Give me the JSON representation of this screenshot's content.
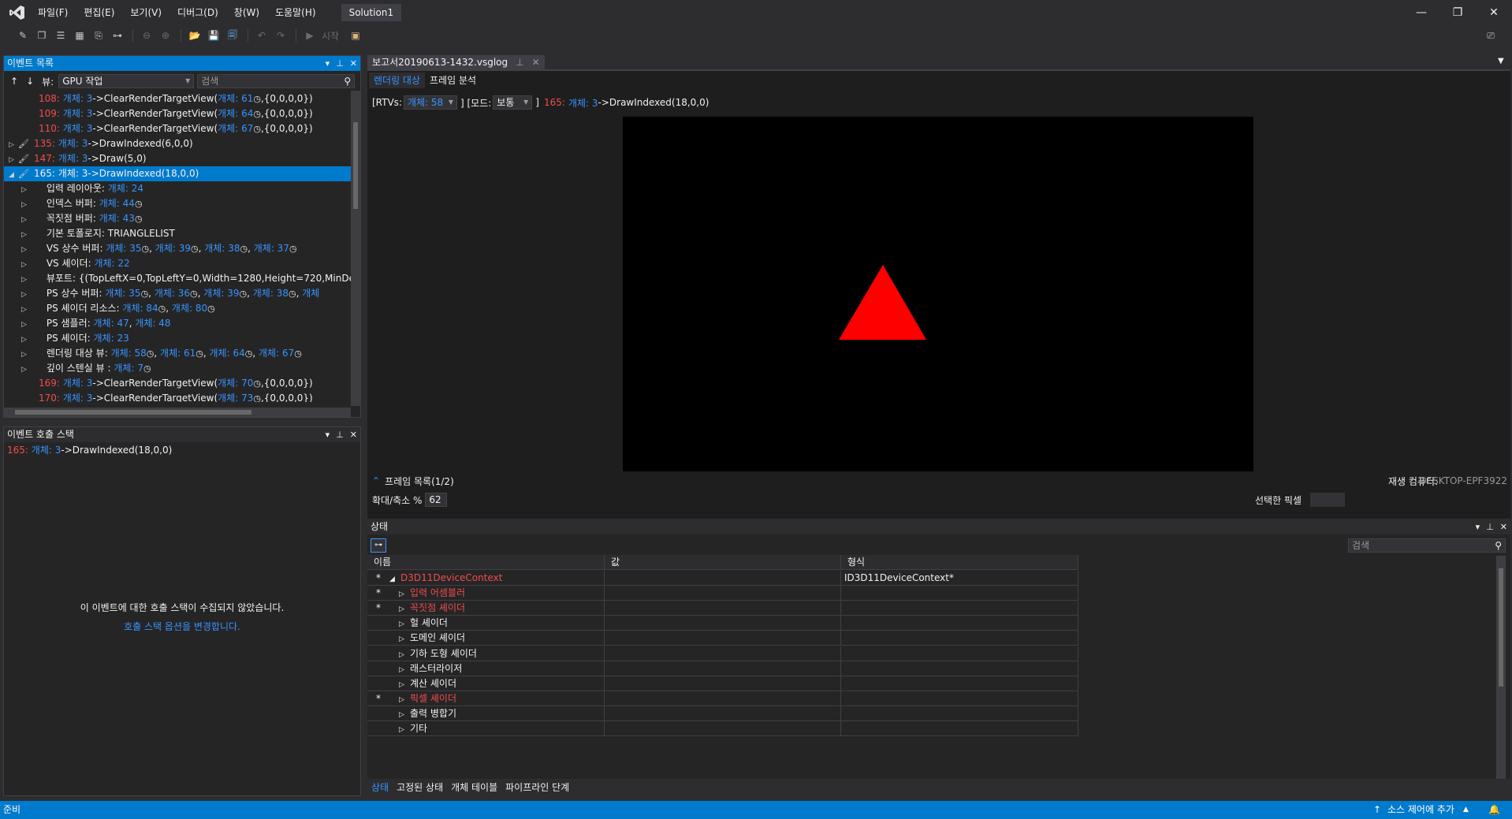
{
  "menu": {
    "items": [
      "파일(F)",
      "편집(E)",
      "보기(V)",
      "디버그(D)",
      "창(W)",
      "도움말(H)"
    ],
    "solution": "Solution1"
  },
  "toolbar": {
    "start_label": "시작"
  },
  "event_list": {
    "title": "이벤트 목록",
    "view_label": "뷰:",
    "view_value": "GPU 작업",
    "search_placeholder": "검색",
    "rows": [
      {
        "id": "108:",
        "obj": "개체: 3",
        "text": "->ClearRenderTargetView(",
        "link": "개체: 61",
        "tail": ",{0,0,0,0})"
      },
      {
        "id": "109:",
        "obj": "개체: 3",
        "text": "->ClearRenderTargetView(",
        "link": "개체: 64",
        "tail": ",{0,0,0,0})"
      },
      {
        "id": "110:",
        "obj": "개체: 3",
        "text": "->ClearRenderTargetView(",
        "link": "개체: 67",
        "tail": ",{0,0,0,0})"
      },
      {
        "id": "135:",
        "obj": "개체: 3",
        "text": "->DrawIndexed(6,0,0)"
      },
      {
        "id": "147:",
        "obj": "개체: 3",
        "text": "->Draw(5,0)"
      },
      {
        "id": "165:",
        "obj": "개체: 3",
        "text": "->DrawIndexed(18,0,0)"
      }
    ],
    "children": [
      {
        "label": "입력 레이아웃:",
        "links": [
          "개체: 24"
        ]
      },
      {
        "label": "인덱스 버퍼:",
        "links": [
          "개체: 44"
        ]
      },
      {
        "label": "꼭짓점 버퍼:",
        "links": [
          "개체: 43"
        ]
      },
      {
        "label": "기본 토폴로지: TRIANGLELIST",
        "links": []
      },
      {
        "label": "VS 상수 버퍼:",
        "links": [
          "개체: 35",
          "개체: 39",
          "개체: 38",
          "개체: 37"
        ]
      },
      {
        "label": "VS 셰이더:",
        "links": [
          "개체: 22"
        ]
      },
      {
        "label": "뷰포트: {(TopLeftX=0,TopLeftY=0,Width=1280,Height=720,MinDepth",
        "links": []
      },
      {
        "label": "PS 상수 버퍼:",
        "links": [
          "개체: 35",
          "개체: 36",
          "개체: 39",
          "개체: 38",
          "개체"
        ]
      },
      {
        "label": "PS 셰이더 리소스:",
        "links": [
          "개체: 84",
          "개체: 80"
        ]
      },
      {
        "label": "PS 샘플러:",
        "links": [
          "개체: 47",
          "개체: 48"
        ]
      },
      {
        "label": "PS 셰이더:",
        "links": [
          "개체: 23"
        ]
      },
      {
        "label": "렌더링 대상 뷰:",
        "links": [
          "개체: 58",
          "개체: 61",
          "개체: 64",
          "개체: 67"
        ]
      },
      {
        "label": "깊이 스텐실 뷰 :",
        "links": [
          "개체: 7"
        ]
      }
    ],
    "tail_rows": [
      {
        "id": "169:",
        "obj": "개체: 3",
        "text": "->ClearRenderTargetView(",
        "link": "개체: 70",
        "tail": ",{0,0,0,0})"
      },
      {
        "id": "170:",
        "obj": "개체: 3",
        "text": "->ClearRenderTargetView(",
        "link": "개체: 73",
        "tail": ",{0,0,0,0})"
      }
    ]
  },
  "call_stack": {
    "title": "이벤트 호출 스택",
    "current": {
      "id": "165:",
      "obj": "개체: 3",
      "text": "->DrawIndexed(18,0,0)"
    },
    "empty_message": "이 이벤트에 대한 호출 스택이 수집되지 않았습니다.",
    "options_link": "호출 스택 옵션을 변경합니다."
  },
  "document": {
    "tab_title": "보고서20190613-1432.vsglog",
    "subtabs": [
      "렌더링 대상",
      "프레임 분석"
    ],
    "rtv_label": "[RTVs:",
    "rtv_value": "개체: 58",
    "mode_label": "] [모드:",
    "mode_value": "보통",
    "event_close": "]",
    "event_id": "165:",
    "event_obj": "개체: 3",
    "event_text": "->DrawIndexed(18,0,0)",
    "frame_list": "프레임 목록(1/2)",
    "playback_label": "재생 컴퓨터:",
    "playback_value": "DESKTOP-EPF3922",
    "zoom_label": "확대/축소 %",
    "zoom_value": "62",
    "selected_pixel_label": "선택한 픽셀"
  },
  "state": {
    "title": "상태",
    "search_placeholder": "검색",
    "columns": [
      "이름",
      "값",
      "형식"
    ],
    "rows": [
      {
        "star": "*",
        "expander": "◢",
        "name": "D3D11DeviceContext",
        "red": true,
        "value": "",
        "type": "ID3D11DeviceContext*",
        "indent": 0
      },
      {
        "star": "*",
        "expander": "▷",
        "name": "입력 어셈블러",
        "red": true,
        "value": "",
        "type": "",
        "indent": 1
      },
      {
        "star": "*",
        "expander": "▷",
        "name": "꼭짓점 셰이더",
        "red": true,
        "value": "",
        "type": "",
        "indent": 1
      },
      {
        "star": "",
        "expander": "▷",
        "name": "헐 셰이더",
        "red": false,
        "value": "",
        "type": "",
        "indent": 1
      },
      {
        "star": "",
        "expander": "▷",
        "name": "도메인 셰이더",
        "red": false,
        "value": "",
        "type": "",
        "indent": 1
      },
      {
        "star": "",
        "expander": "▷",
        "name": "기하 도형 셰이더",
        "red": false,
        "value": "",
        "type": "",
        "indent": 1
      },
      {
        "star": "",
        "expander": "▷",
        "name": "래스터라이저",
        "red": false,
        "value": "",
        "type": "",
        "indent": 1
      },
      {
        "star": "",
        "expander": "▷",
        "name": "계산 셰이더",
        "red": false,
        "value": "",
        "type": "",
        "indent": 1
      },
      {
        "star": "*",
        "expander": "▷",
        "name": "픽셀 셰이더",
        "red": true,
        "value": "",
        "type": "",
        "indent": 1
      },
      {
        "star": "",
        "expander": "▷",
        "name": "출력 병합기",
        "red": false,
        "value": "",
        "type": "",
        "indent": 1
      },
      {
        "star": "",
        "expander": "▷",
        "name": "기타",
        "red": false,
        "value": "",
        "type": "",
        "indent": 1
      }
    ],
    "bottom_tabs": [
      "상태",
      "고정된 상태",
      "개체 테이블",
      "파이프라인 단계"
    ]
  },
  "statusbar": {
    "ready": "준비",
    "source_control": "소스 제어에 추가"
  },
  "colors": {
    "accent": "#007acc",
    "event_id": "#f14c4c",
    "link": "#3794ff",
    "triangle": "#ff0000"
  }
}
